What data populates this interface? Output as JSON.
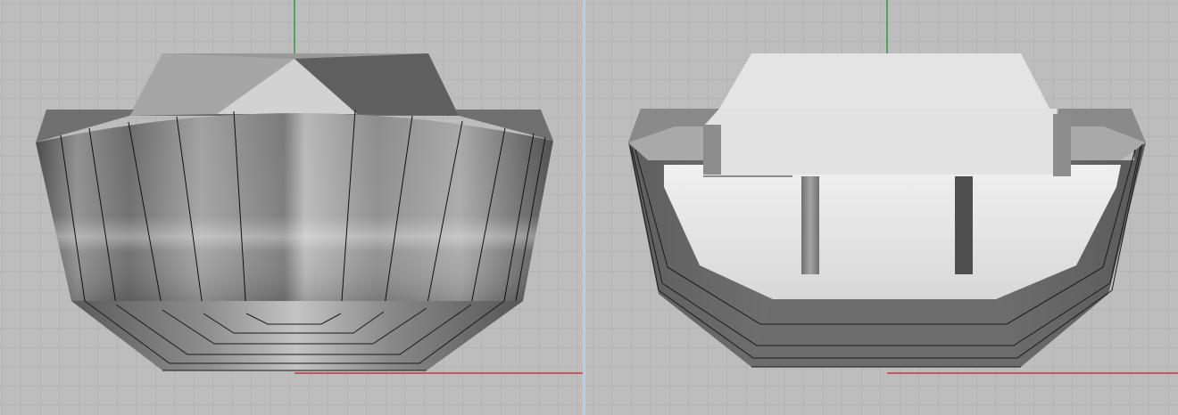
{
  "viewports": [
    {
      "name": "left",
      "view": "shaded"
    },
    {
      "name": "right",
      "view": "section"
    }
  ],
  "colors": {
    "background": "#bdbdbd",
    "grid_minor": "#acacac",
    "grid_major": "#9d9d9d",
    "axis_x": "#c23b3b",
    "axis_y": "#2e9a3e",
    "viewport_divider": "#c9d3e2",
    "model_metal": "#8a8a8a",
    "section_fill": "#e3e3e3"
  }
}
